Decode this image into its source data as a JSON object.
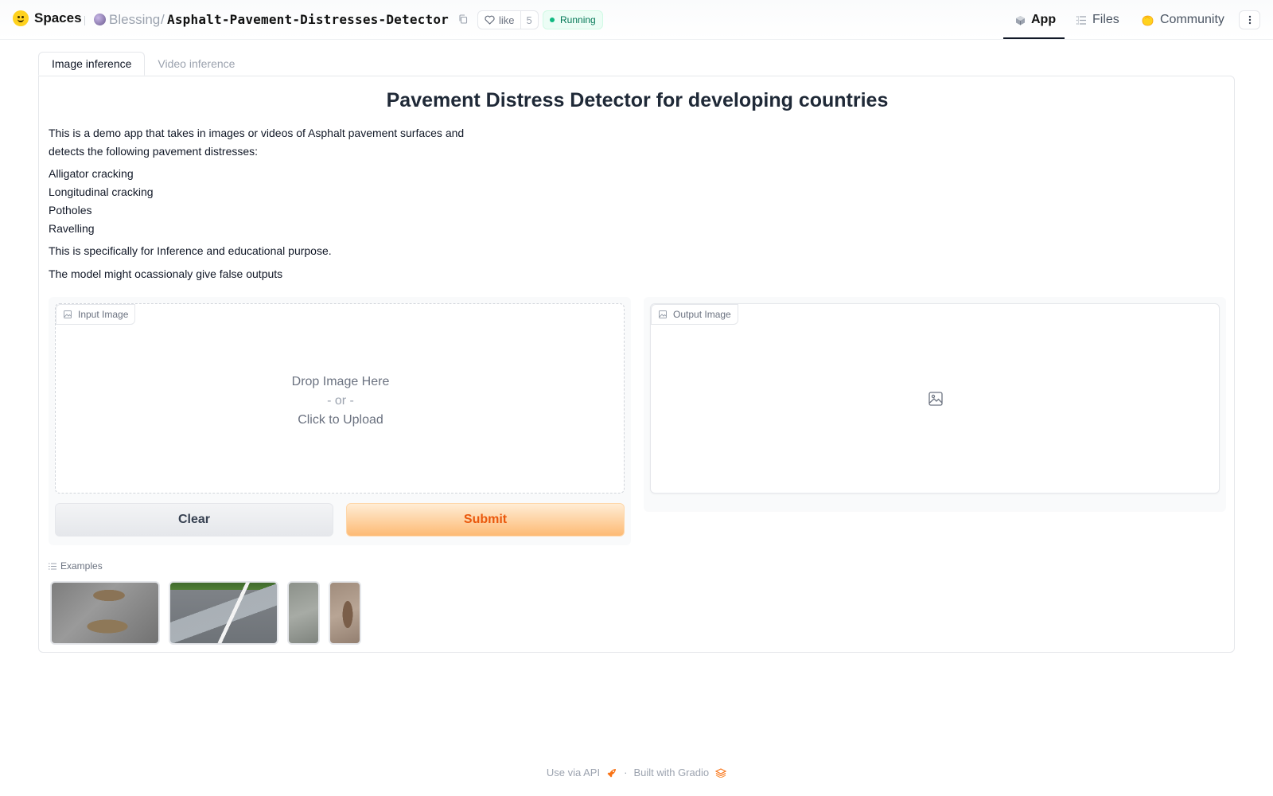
{
  "header": {
    "brand": "Spaces",
    "owner": "Blessing",
    "separator": "/",
    "repo": "Asphalt-Pavement-Distresses-Detector",
    "like_label": "like",
    "like_count": "5",
    "status": "Running",
    "nav": {
      "app": "App",
      "files": "Files",
      "community": "Community"
    }
  },
  "tabs": [
    "Image inference",
    "Video inference"
  ],
  "main": {
    "title": "Pavement Distress Detector for developing countries",
    "intro_line1": "This is a demo app that takes in images or videos of Asphalt pavement surfaces and",
    "intro_line2": "detects the following pavement distresses:",
    "distresses": [
      "Alligator cracking",
      "Longitudinal cracking",
      "Potholes",
      "Ravelling"
    ],
    "note1": "This is specifically for Inference and educational purpose.",
    "note2": "The model might ocassionaly give false outputs"
  },
  "input": {
    "label": "Input Image",
    "drop_text": "Drop Image Here",
    "or_text": "- or -",
    "click_text": "Click to Upload"
  },
  "output": {
    "label": "Output Image"
  },
  "buttons": {
    "clear": "Clear",
    "submit": "Submit"
  },
  "examples": {
    "label": "Examples"
  },
  "footer": {
    "api": "Use via API",
    "dot": "·",
    "built": "Built with Gradio"
  },
  "colors": {
    "accent_orange": "#ea580c",
    "status_green": "#10b981",
    "hf_yellow": "#ffd21e"
  }
}
